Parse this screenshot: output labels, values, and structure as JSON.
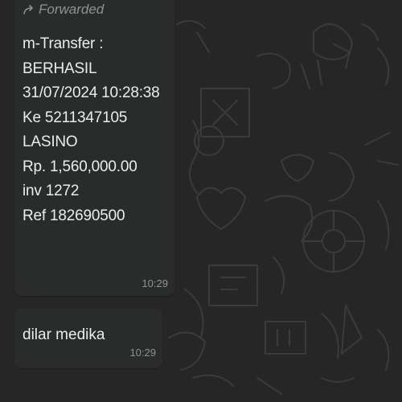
{
  "messages": [
    {
      "forwarded_label": "Forwarded",
      "lines": [
        "m-Transfer :",
        "BERHASIL",
        "31/07/2024 10:28:38",
        "Ke 5211347105",
        "LASINO",
        "Rp. 1,560,000.00",
        "inv 1272",
        "Ref 182690500"
      ],
      "time": "10:29"
    },
    {
      "text": "dilar medika",
      "time": "10:29"
    }
  ],
  "colors": {
    "background": "#252625",
    "bubble": "#2a2b2b",
    "text": "#e9edef",
    "meta": "#8c9497"
  },
  "icons": {
    "forward": "forward-arrow-icon"
  }
}
